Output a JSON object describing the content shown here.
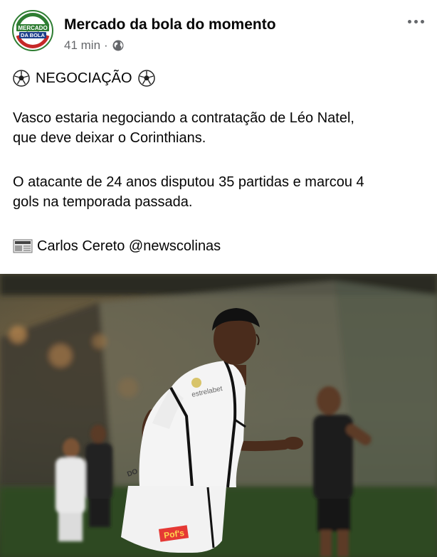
{
  "post": {
    "page_name": "Mercado da bola do momento",
    "time": "41 min",
    "separator": "·",
    "avatar_logo": {
      "line1": "MERCADO",
      "line2": "DA BOLA"
    },
    "icons": {
      "more": "more-horizontal-icon",
      "audience": "globe-icon",
      "emoji_ball": "soccer-ball-icon",
      "emoji_news": "newspaper-icon"
    },
    "headline": "NEGOCIAÇÃO",
    "body": {
      "p1_line1": "Vasco estaria negociando a contratação de Léo Natel,",
      "p1_line2": "que deve deixar o Corinthians.",
      "p2_line1": "O atacante de 24 anos disputou 35 partidas e marcou 4",
      "p2_line2": "gols na temporada passada."
    },
    "credit": "Carlos Cereto @newscolinas"
  },
  "photo": {
    "jersey_sponsor": "estrelabet",
    "shorts_sponsor": "Pof's",
    "sleeve_text": "DO"
  },
  "colors": {
    "text": "#050505",
    "meta": "#65676b",
    "logo_green": "#2e7d32",
    "logo_red": "#c62828"
  }
}
